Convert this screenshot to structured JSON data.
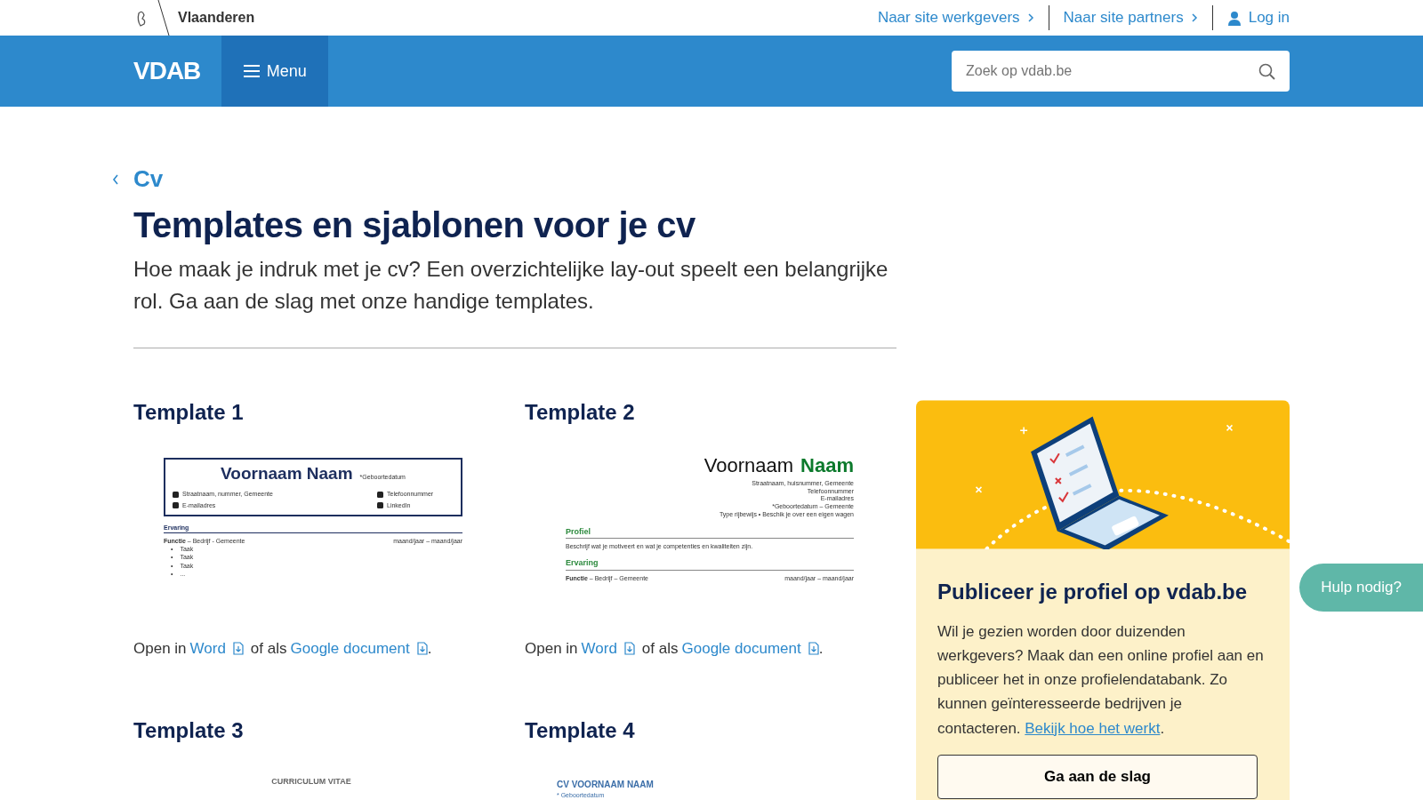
{
  "topbar": {
    "brand": "Vlaanderen",
    "links": [
      {
        "label": "Naar site werkgevers",
        "kind": "chevron"
      },
      {
        "label": "Naar site partners",
        "kind": "chevron"
      },
      {
        "label": "Log in",
        "kind": "user"
      }
    ]
  },
  "header": {
    "logo": "VDAB",
    "menu": "Menu",
    "search": {
      "placeholder": "Zoek op vdab.be"
    }
  },
  "breadcrumb": "Cv",
  "title": "Templates en sjablonen voor je cv",
  "intro": "Hoe maak je indruk met je cv? Een overzichtelijke lay-out speelt een belangrijke rol. Ga aan de slag met onze handige templates.",
  "templates": [
    {
      "title": "Template 1",
      "preview": {
        "kind": "boxed",
        "first_name": "Voornaam Naam",
        "birth": "*Geboortedatum",
        "contacts": [
          "Straatnaam, nummer, Gemeente",
          "Telefoonnummer",
          "E-mailadres",
          "LinkedIn"
        ],
        "section": "Ervaring",
        "job": "**Functie** – Bedrijf - Gemeente",
        "dates": "maand/jaar – maand/jaar",
        "bullet": "•",
        "tasks": [
          "Taak",
          "Taak",
          "Taak",
          "..."
        ]
      },
      "links": {
        "open": "Open in",
        "word": "Word",
        "or": "of als",
        "google": "Google document",
        "end": "."
      }
    },
    {
      "title": "Template 2",
      "preview": {
        "kind": "green",
        "first_name": "Voornaam",
        "last_name": "Naam",
        "lines": [
          "Straatnaam, huisnummer, Gemeente",
          "Telefoonnummer",
          "E-mailadres",
          "*Geboortedatum – Gemeente",
          "Type rijbewijs • Beschik je over een eigen wagen"
        ],
        "section": "Profiel",
        "text": "Beschrijf wat je motiveert en wat je competenties en kwaliteiten zijn.",
        "section2": "Ervaring",
        "job": "**Functie** – Bedrijf – Gemeente",
        "dates": "maand/jaar – maand/jaar"
      },
      "links": {
        "open": "Open in",
        "word": "Word",
        "or": "of als",
        "google": "Google document",
        "end": "."
      }
    },
    {
      "title": "Template 3",
      "preview": {
        "kind": "plain",
        "heading": "CURRICULUM VITAE"
      }
    },
    {
      "title": "Template 4",
      "preview": {
        "kind": "blue",
        "heading": "CV VOORNAAM NAAM",
        "birth": "* Geboortedatum"
      }
    }
  ],
  "promo": {
    "title": "Publiceer je profiel op vdab.be",
    "text": "Wil je gezien worden door duizenden werkgevers? Maak dan een online profiel aan en publiceer het in onze profielendatabank. Zo kunnen geïnteresseerde bedrijven je contacteren.",
    "link": "Bekijk hoe het werkt",
    "end": ".",
    "button": "Ga aan de slag"
  },
  "help": "Hulp nodig?"
}
